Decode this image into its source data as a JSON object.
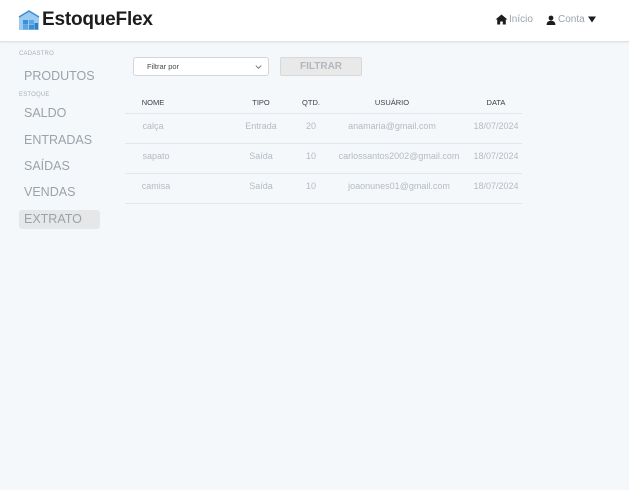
{
  "header": {
    "app_name": "EstoqueFlex",
    "nav": {
      "home_label": "Início",
      "account_label": "Conta"
    },
    "icons": {
      "logo": "warehouse-boxes-icon",
      "home": "home-icon",
      "account": "user-icon",
      "account_caret": "caret-down-icon"
    }
  },
  "sidebar": {
    "sections": [
      {
        "label": "CADASTRO",
        "items": [
          {
            "label": "PRODUTOS"
          }
        ]
      },
      {
        "label": "ESTOQUE",
        "items": [
          {
            "label": "SALDO"
          },
          {
            "label": "ENTRADAS"
          },
          {
            "label": "SAÍDAS"
          },
          {
            "label": "VENDAS"
          },
          {
            "label": "EXTRATO",
            "active": true
          }
        ]
      }
    ]
  },
  "filters": {
    "select_placeholder": "Filtrar por",
    "button_label": "FILTRAR"
  },
  "table": {
    "columns": [
      "NOME",
      "TIPO",
      "QTD.",
      "USUÁRIO",
      "DATA"
    ],
    "rows": [
      [
        "calça",
        "Entrada",
        "20",
        "anamaria@gmail.com",
        "18/07/2024"
      ],
      [
        "sapato",
        "Saída",
        "10",
        "carlossantos2002@gmail.com",
        "18/07/2024"
      ],
      [
        "camisa",
        "Saída",
        "10",
        "joaonunes01@gmail.com",
        "18/07/2024"
      ]
    ]
  },
  "colors": {
    "background": "#f5f8fb",
    "header_bg": "#ffffff",
    "logo_blue": "#3a8fd6",
    "active_item_bg": "#e6e7e9",
    "muted_text": "#9aa2aa"
  }
}
